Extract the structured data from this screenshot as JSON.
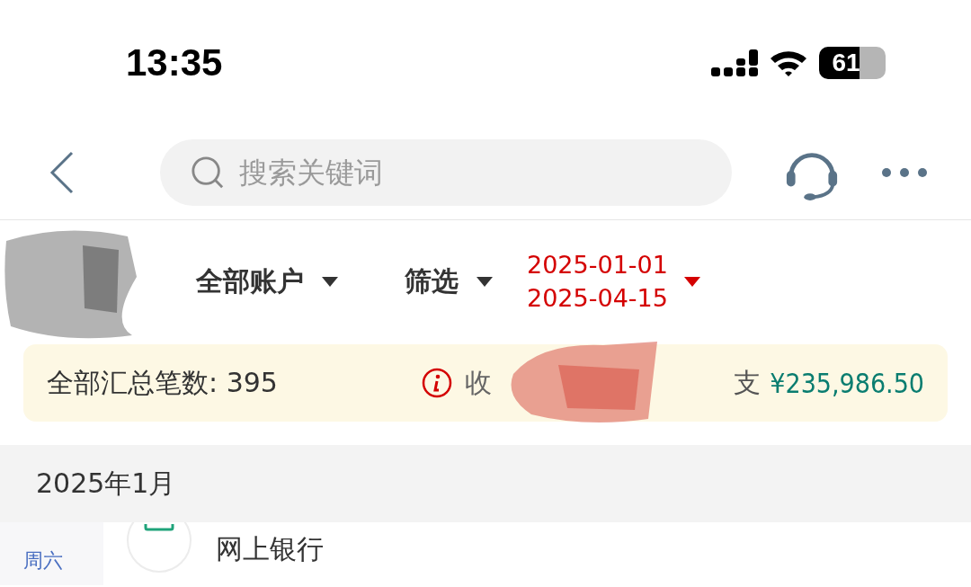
{
  "status_bar": {
    "time": "13:35",
    "battery": "61"
  },
  "search": {
    "placeholder": "搜索关键词"
  },
  "filters": [
    {
      "kind": "dropdown",
      "label": "全部账户"
    },
    {
      "kind": "dropdown",
      "label": "筛选"
    },
    {
      "kind": "dates",
      "lines": [
        "2025-01-01",
        "2025-04-15"
      ]
    }
  ],
  "summary": {
    "count_label": "全部汇总笔数: 395",
    "income_label": "收",
    "expense_label": "支",
    "expense_amount": "¥235,986.50"
  },
  "month_header": "2025年1月",
  "transactions": [
    {
      "weekday": "周六",
      "title": "网上银行"
    }
  ]
}
